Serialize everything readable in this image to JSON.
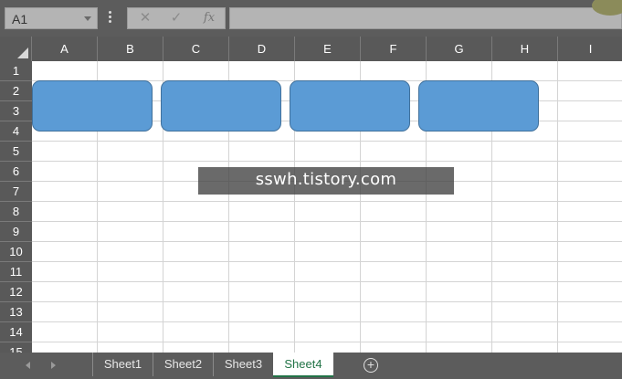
{
  "formula_bar": {
    "name_box": "A1",
    "fx_label": "fx",
    "formula_value": ""
  },
  "columns": [
    "A",
    "B",
    "C",
    "D",
    "E",
    "F",
    "G",
    "H",
    "I"
  ],
  "rows": [
    "1",
    "2",
    "3",
    "4",
    "5",
    "6",
    "7",
    "8",
    "9",
    "10",
    "11",
    "12",
    "13",
    "14",
    "15"
  ],
  "shapes": [
    {
      "text": "",
      "fill": "#5b9bd5"
    },
    {
      "text": "",
      "fill": "#5b9bd5"
    },
    {
      "text": "",
      "fill": "#5b9bd5"
    },
    {
      "text": "",
      "fill": "#5b9bd5"
    }
  ],
  "watermark": "sswh.tistory.com",
  "sheet_tabs": [
    "Sheet1",
    "Sheet2",
    "Sheet3",
    "Sheet4"
  ],
  "active_sheet": "Sheet4",
  "colors": {
    "chrome": "#5c5c5c",
    "shape_fill": "#5b9bd5",
    "active_tab_text": "#217346"
  }
}
